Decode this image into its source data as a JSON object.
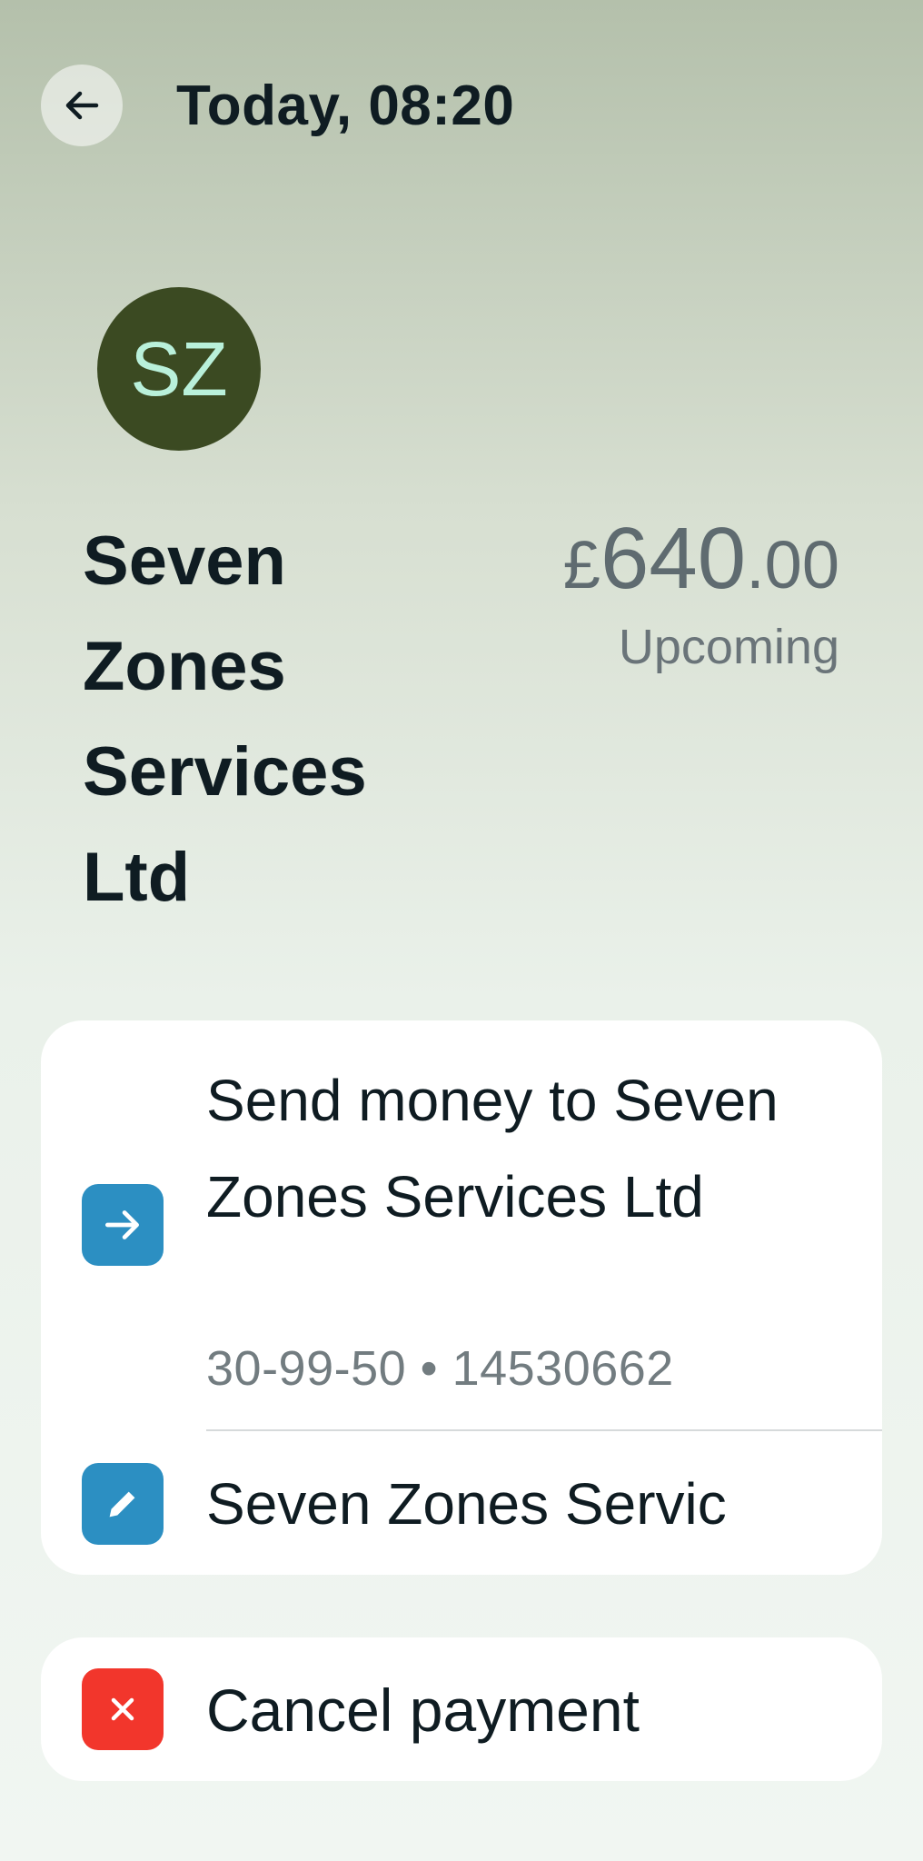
{
  "header": {
    "title": "Today, 08:20",
    "back_icon": "arrow-left-icon"
  },
  "merchant": {
    "initials": "SZ",
    "name": "Seven Zones Services Ltd",
    "avatar_color": "#3b4a22",
    "initials_color": "#b9f0da"
  },
  "amount": {
    "currency": "£",
    "major": "640",
    "minor": ".00",
    "status": "Upcoming"
  },
  "send_card": {
    "label": "Send money to Seven Zones Services Ltd",
    "account": "30-99-50 • 14530662",
    "icon": "arrow-right-icon",
    "reference": "Seven Zones Servic",
    "reference_icon": "pencil-icon",
    "accent": "#2c8fc2"
  },
  "cancel_card": {
    "label": "Cancel payment",
    "icon": "close-icon",
    "accent": "#f2362c"
  }
}
